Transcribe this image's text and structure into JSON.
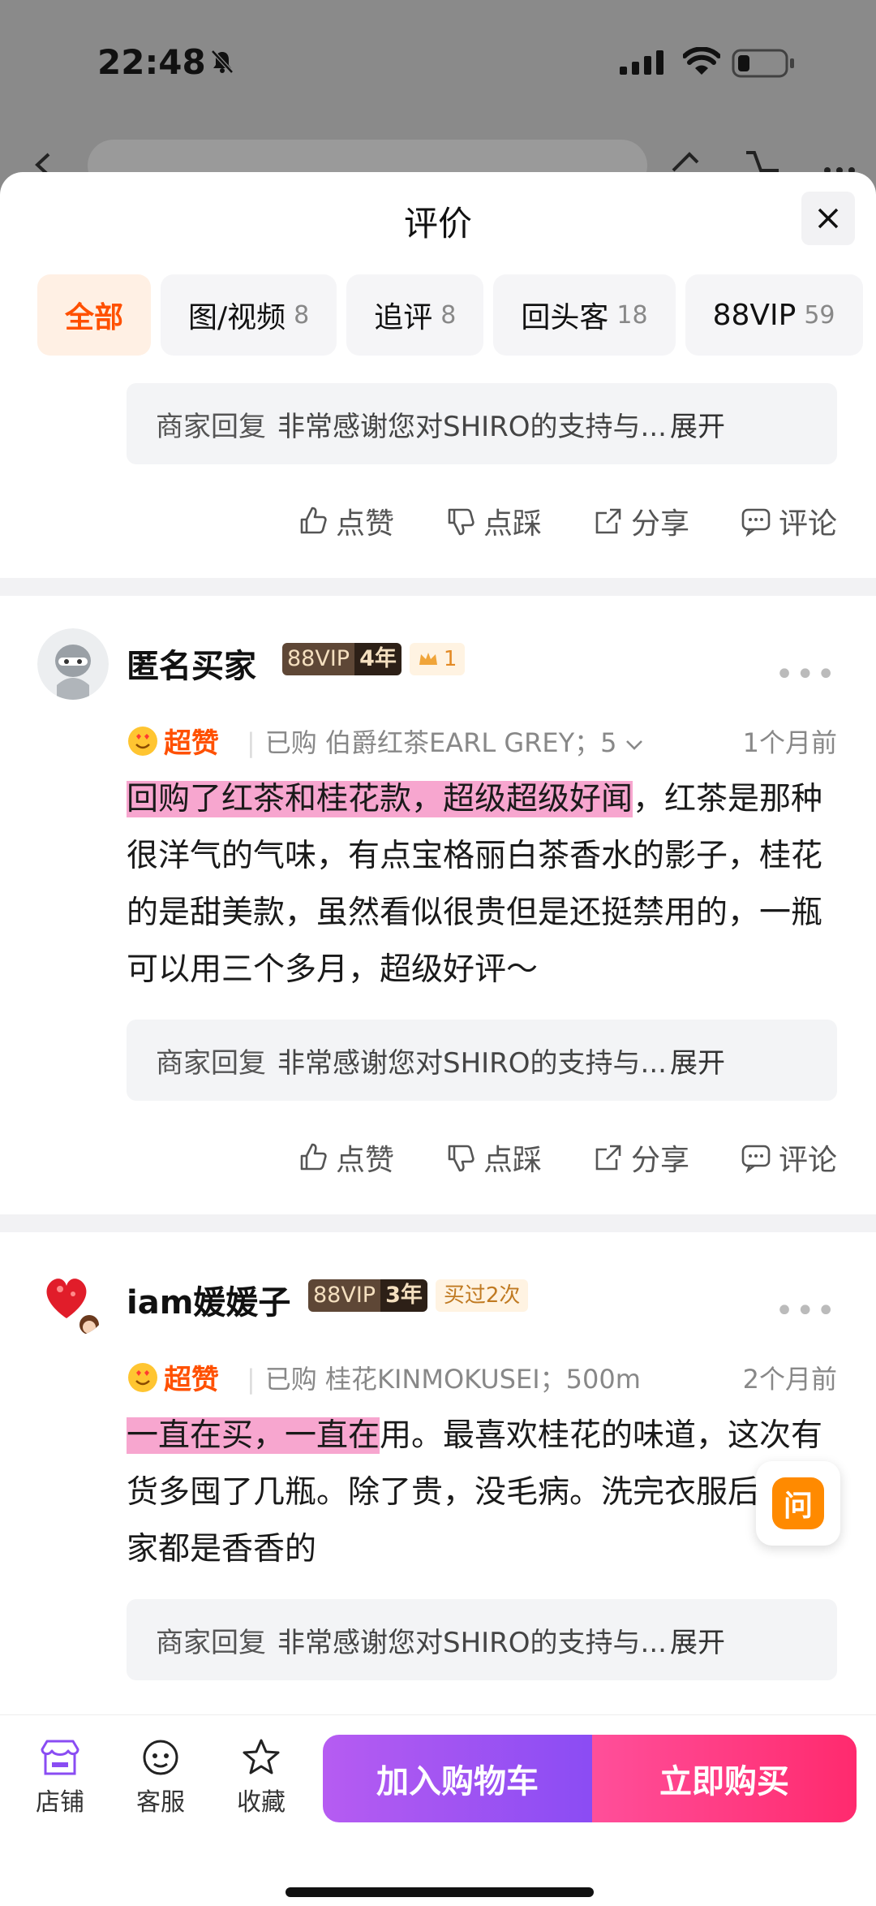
{
  "status_bar": {
    "time": "22:48"
  },
  "sheet": {
    "title": "评价",
    "tabs": [
      {
        "label": "全部",
        "count": ""
      },
      {
        "label": "图/视频",
        "count": "8"
      },
      {
        "label": "追评",
        "count": "8"
      },
      {
        "label": "回头客",
        "count": "18"
      },
      {
        "label": "88VIP",
        "count": "59"
      }
    ]
  },
  "reply": {
    "label": "商家回复",
    "text": "非常感谢您对SHIRO的支持与...",
    "expand": "展开"
  },
  "actions": {
    "like": "点赞",
    "dislike": "点踩",
    "share": "分享",
    "comment": "评论"
  },
  "reviews": [
    {
      "user": "匿名买家",
      "vip": "88VIP",
      "vip_years": "4年",
      "crown_count": "1",
      "rating": "超赞",
      "purchased_prefix": "已购",
      "purchased": "伯爵红茶EARL GREY；5",
      "time": "1个月前",
      "highlight": "回购了红茶和桂花款，超级超级好闻",
      "body": "，红茶是那种很洋气的气味，有点宝格丽白茶香水的影子，桂花的是甜美款，虽然看似很贵但是还挺禁用的，一瓶可以用三个多月，超级好评～"
    },
    {
      "user": "iam媛媛子",
      "vip": "88VIP",
      "vip_years": "3年",
      "rebuy": "买过2次",
      "rating": "超赞",
      "purchased_prefix": "已购",
      "purchased": "桂花KINMOKUSEI；500m",
      "time": "2个月前",
      "highlight": "一直在买，一直在",
      "body": "用。最喜欢桂花的味道，这次有货多囤了几瓶。除了贵，没毛病。洗完衣服后整个家都是香香的"
    }
  ],
  "ask": {
    "label": "问"
  },
  "bottom_bar": {
    "store": "店铺",
    "service": "客服",
    "favorite": "收藏",
    "add_to_cart": "加入购物车",
    "buy_now": "立即购买"
  }
}
